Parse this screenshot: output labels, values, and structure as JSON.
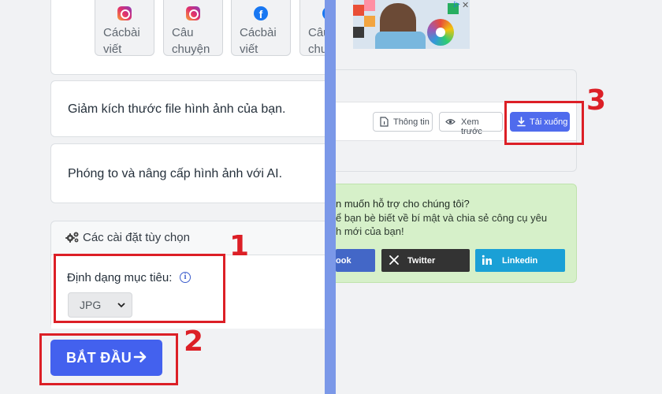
{
  "left": {
    "social_buttons": [
      {
        "label": "Cácbài viết",
        "icon": "instagram-icon"
      },
      {
        "label": "Câu chuyện",
        "icon": "instagram-icon"
      },
      {
        "label": "Cácbài viết",
        "icon": "facebook-icon"
      },
      {
        "label": "Câu chuyện",
        "icon": "facebook-icon"
      }
    ],
    "compress_option": "Giảm kích thước file hình ảnh của bạn.",
    "upscale_option": "Phóng to và nâng cấp hình ảnh với AI.",
    "settings": {
      "title": "Các cài đặt tùy chọn",
      "format_label": "Định dạng mục tiêu:",
      "format_value": "JPG"
    },
    "start_button": "BẮT ĐẦU"
  },
  "right": {
    "file_actions": {
      "info": "Thông tin",
      "preview": "Xem trước",
      "download": "Tải xuống"
    },
    "support": {
      "title": "n muốn hỗ trợ cho chúng tôi?",
      "line1": "ể bạn bè biết về bí mật và chia sẻ công cụ yêu",
      "line2": "h mới của bạn!",
      "buttons": {
        "facebook": "ook",
        "twitter": "Twitter",
        "linkedin": "Linkedin"
      }
    }
  },
  "annotations": {
    "step1": "1",
    "step2": "2",
    "step3": "3"
  },
  "colors": {
    "primary": "#4361ee",
    "divider": "#7b98e8",
    "annotation": "#dc1f26",
    "support_bg": "#d6f0c9",
    "twitter": "#333333",
    "linkedin": "#1aa0d6",
    "facebook": "#4367c7"
  }
}
